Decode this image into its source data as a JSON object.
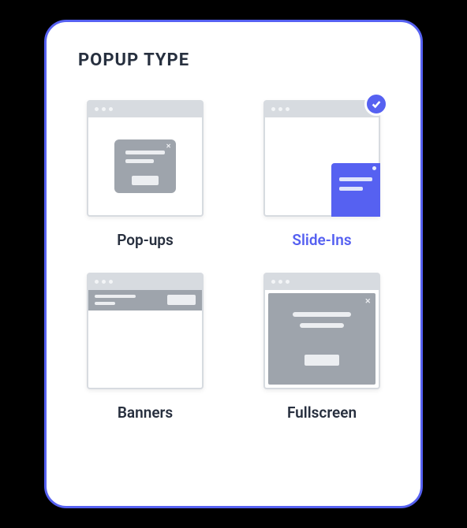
{
  "panel": {
    "title": "POPUP TYPE"
  },
  "options": {
    "popups": {
      "label": "Pop-ups",
      "selected": false
    },
    "slideins": {
      "label": "Slide-Ins",
      "selected": true
    },
    "banners": {
      "label": "Banners",
      "selected": false
    },
    "fullscreen": {
      "label": "Fullscreen",
      "selected": false
    }
  }
}
